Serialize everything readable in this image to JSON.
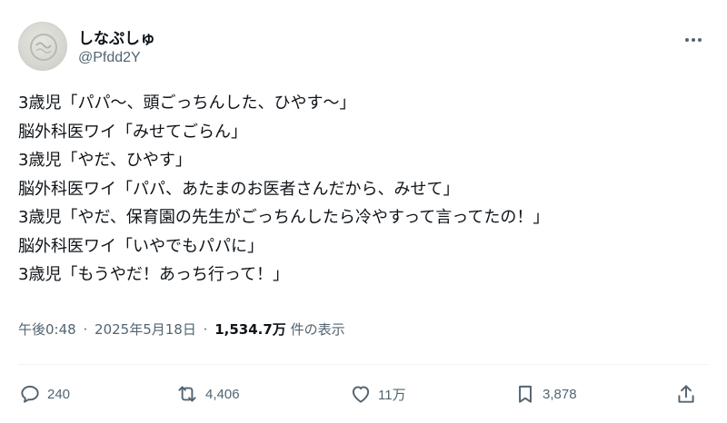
{
  "author": {
    "display_name": "しなぷしゅ",
    "handle": "@Pfdd2Y"
  },
  "tweet": {
    "lines": [
      "3歳児「パパ〜、頭ごっちんした、ひやす〜」",
      "脳外科医ワイ「みせてごらん」",
      "3歳児「やだ、ひやす」",
      "脳外科医ワイ「パパ、あたまのお医者さんだから、みせて」",
      "3歳児「やだ、保育園の先生がごっちんしたら冷やすって言ってたの！」",
      "脳外科医ワイ「いやでもパパに」",
      "3歳児「もうやだ！あっち行って！」"
    ]
  },
  "meta": {
    "time": "午後0:48",
    "separator": "·",
    "date": "2025年5月18日",
    "views": "1,534.7万",
    "views_suffix": "件の表示"
  },
  "actions": {
    "reply_count": "240",
    "retweet_count": "4,406",
    "like_count": "11万",
    "bookmark_count": "3,878"
  },
  "icons": {
    "more": "more-horizontal-icon",
    "reply": "reply-icon",
    "retweet": "retweet-icon",
    "like": "heart-icon",
    "bookmark": "bookmark-icon",
    "share": "share-icon"
  },
  "colors": {
    "text": "#0f1419",
    "secondary": "#536471",
    "divider": "#eff3f4"
  }
}
